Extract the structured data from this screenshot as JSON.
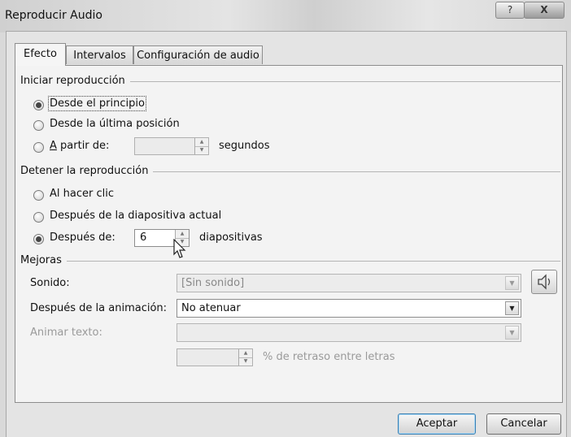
{
  "window": {
    "title": "Reproducir Audio",
    "help_label": "?",
    "close_label": "X"
  },
  "tabs": [
    {
      "label": "Efecto",
      "active": true
    },
    {
      "label": "Intervalos",
      "active": false
    },
    {
      "label": "Configuración de audio",
      "active": false
    }
  ],
  "start_group": {
    "title": "Iniciar reproducción",
    "options": [
      {
        "label": "Desde el principio",
        "checked": true
      },
      {
        "label": "Desde la última posición",
        "checked": false
      },
      {
        "label_prefix": "A",
        "label_rest": " partir de:",
        "checked": false
      }
    ],
    "from_value": "",
    "from_unit": "segundos"
  },
  "stop_group": {
    "title": "Detener la reproducción",
    "options": [
      {
        "label": "Al hacer clic",
        "checked": false
      },
      {
        "label": "Después de la diapositiva actual",
        "checked": false
      },
      {
        "label": "Después de:",
        "checked": true
      }
    ],
    "after_value": "6",
    "after_unit": "diapositivas"
  },
  "enhance_group": {
    "title": "Mejoras",
    "sound_label": "Sonido:",
    "sound_value": "[Sin sonido]",
    "after_anim_label": "Después de la animación:",
    "after_anim_value": "No atenuar",
    "animate_text_label": "Animar texto:",
    "animate_text_value": "",
    "delay_value": "",
    "delay_label": "% de retraso entre letras"
  },
  "buttons": {
    "ok": "Aceptar",
    "cancel": "Cancelar"
  }
}
